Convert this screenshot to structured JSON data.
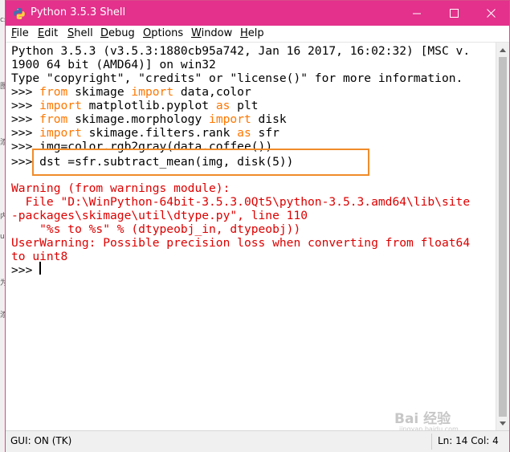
{
  "window": {
    "title": "Python 3.5.3 Shell",
    "controls": {
      "minimize": "—",
      "maximize": "☐",
      "close": "✕"
    }
  },
  "menu": [
    {
      "ul": "F",
      "rest": "ile"
    },
    {
      "ul": "E",
      "rest": "dit"
    },
    {
      "ul": "S",
      "rest": "hell"
    },
    {
      "ul": "D",
      "rest": "ebug"
    },
    {
      "ul": "O",
      "rest": "ptions"
    },
    {
      "ul": "W",
      "rest": "indow"
    },
    {
      "ul": "H",
      "rest": "elp"
    }
  ],
  "shell": {
    "banner_1": "Python 3.5.3 (v3.5.3:1880cb95a742, Jan 16 2017, 16:02:32) [MSC v.",
    "banner_2": "1900 64 bit (AMD64)] on win32",
    "banner_3": "Type \"copyright\", \"credits\" or \"license()\" for more information.",
    "prompt": ">>> ",
    "cmd1": {
      "kw1": "from",
      "mod": " skimage ",
      "kw2": "import",
      "rest": " data,color"
    },
    "cmd2": {
      "kw1": "import",
      "mod": " matplotlib.pyplot ",
      "kw2": "as",
      "rest": " plt"
    },
    "cmd3": {
      "kw1": "from",
      "mod": " skimage.morphology ",
      "kw2": "import",
      "rest": " disk"
    },
    "cmd4": {
      "kw1": "import",
      "mod": " skimage.filters.rank ",
      "kw2": "as",
      "rest": " sfr"
    },
    "cmd5": "img=color.rgb2gray(data.coffee())",
    "cmd6": "dst =sfr.subtract_mean(img, disk(5))",
    "warn_1": "Warning (from warnings module):",
    "warn_2": "  File \"D:\\WinPython-64bit-3.5.3.0Qt5\\python-3.5.3.amd64\\lib\\site",
    "warn_3": "-packages\\skimage\\util\\dtype.py\", line 110",
    "warn_4": "    \"%s to %s\" % (dtypeobj_in, dtypeobj))",
    "warn_5": "UserWarning: Possible precision loss when converting from float64",
    "warn_6": "to uint8"
  },
  "status": {
    "left": "GUI: ON (TK)",
    "right": "Ln: 14  Col: 4"
  },
  "background_fragments": [
    "cs",
    "图",
    "添",
    "内",
    "u",
    "为",
    "添"
  ],
  "watermark": {
    "text": "Bai 经验",
    "sub": "jingyan.baidu.com"
  },
  "colors": {
    "titlebar": "#e3318c",
    "keyword": "#ff7700",
    "error": "#dd0000",
    "highlight": "#f08c2a"
  }
}
